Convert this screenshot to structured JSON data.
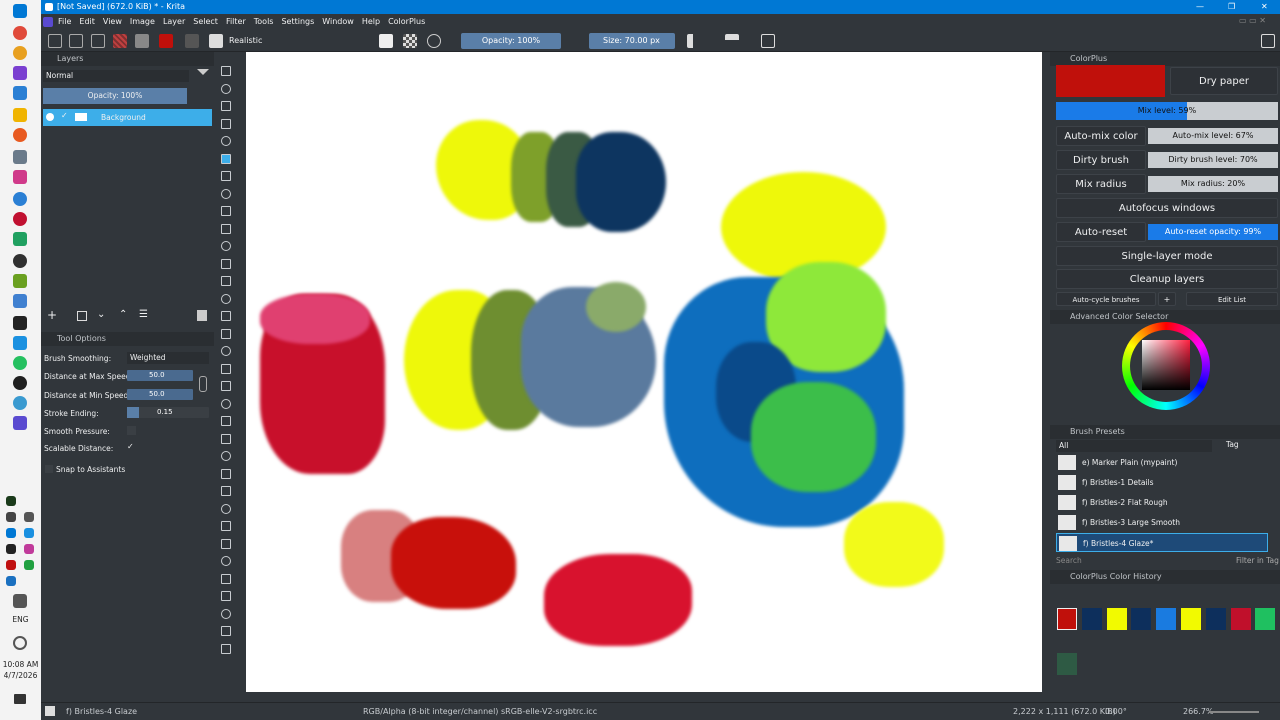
{
  "window": {
    "title": "[Not Saved]  (672.0 KiB) * - Krita"
  },
  "menu": [
    "File",
    "Edit",
    "View",
    "Image",
    "Layer",
    "Select",
    "Filter",
    "Tools",
    "Settings",
    "Window",
    "Help",
    "ColorPlus"
  ],
  "toolbar": {
    "brush_preset": "Realistic",
    "opacity": "Opacity: 100%",
    "size": "Size: 70.00 px"
  },
  "layers": {
    "title": "Layers",
    "blend_mode": "Normal",
    "opacity": "Opacity: 100%",
    "items": [
      {
        "name": "Background"
      }
    ]
  },
  "tool_options": {
    "title": "Tool Options",
    "brush_smoothing_label": "Brush Smoothing:",
    "brush_smoothing_value": "Weighted",
    "dist_max_label": "Distance at Max Speed:",
    "dist_max_value": "50.0",
    "dist_min_label": "Distance at Min Speed:",
    "dist_min_value": "50.0",
    "stroke_ending_label": "Stroke Ending:",
    "stroke_ending_value": "0.15",
    "smooth_pressure_label": "Smooth Pressure:",
    "scalable_distance_label": "Scalable Distance:",
    "snap_label": "Snap to Assistants"
  },
  "colorplus": {
    "title": "ColorPlus",
    "dry_paper": "Dry paper",
    "mix_level": "Mix level: 59%",
    "auto_mix_color": "Auto-mix color",
    "auto_mix_level": "Auto-mix level: 67%",
    "dirty_brush": "Dirty brush",
    "dirty_brush_level": "Dirty brush level: 70%",
    "mix_radius": "Mix radius",
    "mix_radius_value": "Mix radius: 20%",
    "autofocus_windows": "Autofocus windows",
    "auto_reset_opacity": "Auto-reset opacity",
    "auto_reset_opacity_value": "Auto-reset opacity: 99%",
    "single_layer_mode": "Single-layer mode",
    "cleanup_layers": "Cleanup layers",
    "auto_cycle_brushes": "Auto-cycle brushes",
    "plus": "+",
    "edit_list": "Edit List",
    "current_color": "#c0100b"
  },
  "advanced_color_selector": {
    "title": "Advanced Color Selector"
  },
  "brush_presets": {
    "title": "Brush Presets",
    "filter": "All",
    "tag_label": "Tag",
    "items": [
      {
        "name": "e) Marker Plain (mypaint)"
      },
      {
        "name": "f) Bristles-1 Details"
      },
      {
        "name": "f) Bristles-2 Flat Rough"
      },
      {
        "name": "f) Bristles-3 Large Smooth"
      },
      {
        "name": "f) Bristles-4 Glaze*"
      }
    ],
    "search_placeholder": "Search",
    "filter_in_tag": "Filter in Tag"
  },
  "color_history": {
    "title": "ColorPlus Color History",
    "swatches": [
      "#c0100b",
      "#0d2f5c",
      "#f2fa00",
      "#0d2f5c",
      "#1a7be0",
      "#f2fa00",
      "#0d2f5c",
      "#c0102b",
      "#1fc060"
    ],
    "extra_swatch": "#2e5a44"
  },
  "statusbar": {
    "preset": "f) Bristles-4 Glaze",
    "color_info": "RGB/Alpha (8-bit integer/channel)  sRGB-elle-V2-srgbtrc.icc",
    "dimensions": "2,222 x 1,111 (672.0 KiB)",
    "rotation": "0.00°",
    "zoom": "266.7%"
  },
  "taskbar": {
    "time": "10:08 AM",
    "date": "4/7/2026",
    "lang": "ENG"
  }
}
